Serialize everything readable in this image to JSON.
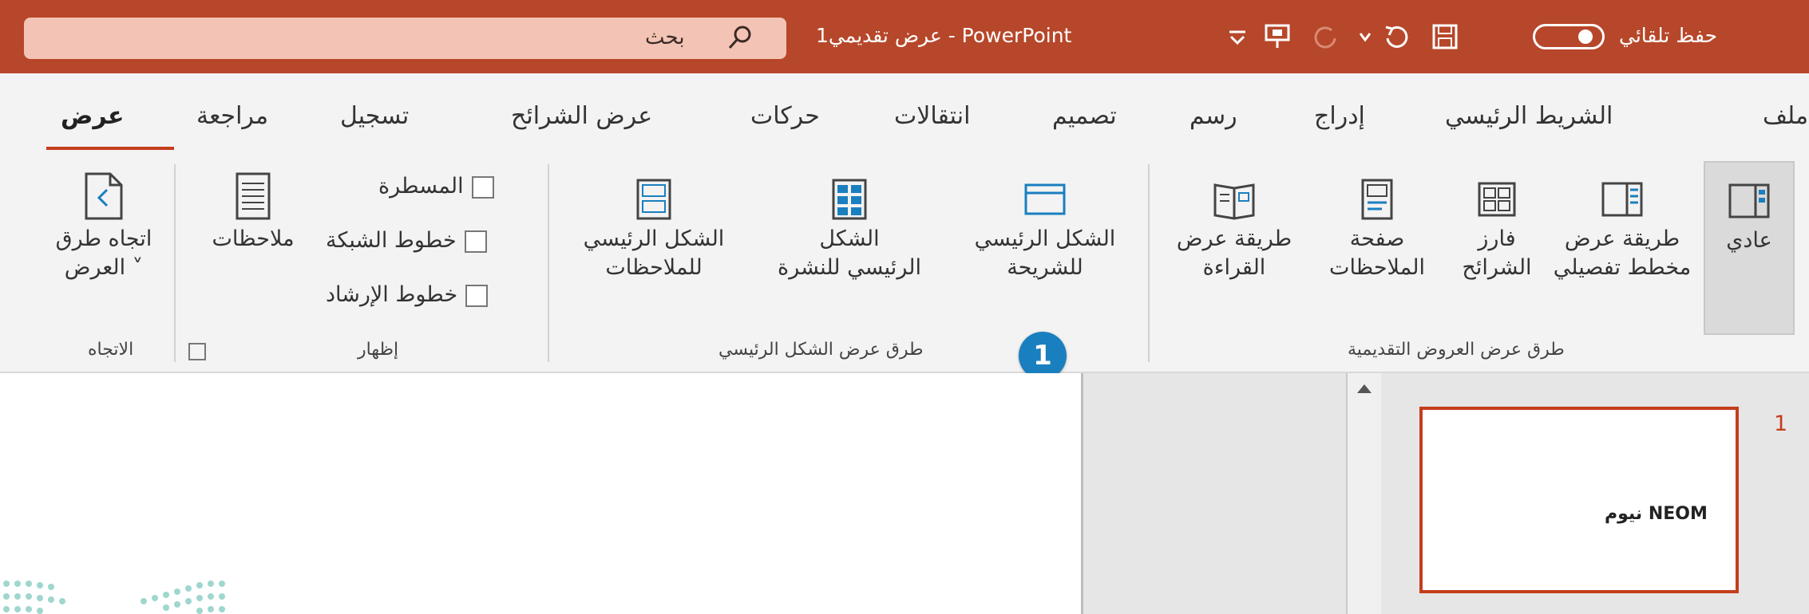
{
  "titlebar": {
    "autosave_label": "حفظ تلقائي",
    "doc_title": "عرض تقديمي1 - PowerPoint",
    "search_placeholder": "بحث",
    "color": "#b7472a"
  },
  "tabs": [
    {
      "label": "ملف"
    },
    {
      "label": "الشريط الرئيسي"
    },
    {
      "label": "إدراج"
    },
    {
      "label": "رسم"
    },
    {
      "label": "تصميم"
    },
    {
      "label": "انتقالات"
    },
    {
      "label": "حركات"
    },
    {
      "label": "عرض الشرائح"
    },
    {
      "label": "تسجيل"
    },
    {
      "label": "مراجعة"
    },
    {
      "label": "عرض",
      "active": true
    }
  ],
  "ribbon": {
    "presentation_views": {
      "group_label": "طرق عرض العروض التقديمية",
      "normal": "عادي",
      "outline_1": "طريقة عرض",
      "outline_2": "مخطط تفصيلي",
      "sorter_1": "فارز",
      "sorter_2": "الشرائح",
      "notes_page_1": "صفحة",
      "notes_page_2": "الملاحظات",
      "reading_1": "طريقة عرض",
      "reading_2": "القراءة"
    },
    "master_views": {
      "group_label": "طرق عرض الشكل الرئيسي",
      "slide_master_1": "الشكل الرئيسي",
      "slide_master_2": "للشريحة",
      "handout_master_1": "الشكل",
      "handout_master_2": "الرئيسي للنشرة",
      "notes_master_1": "الشكل الرئيسي",
      "notes_master_2": "للملاحظات"
    },
    "show": {
      "group_label": "إظهار",
      "ruler": "المسطرة",
      "gridlines": "خطوط الشبكة",
      "guides": "خطوط الإرشاد",
      "notes": "ملاحظات"
    },
    "direction": {
      "group_label": "الاتجاه",
      "label_1": "اتجاه طرق",
      "label_2": "العرض ˅"
    }
  },
  "callout": {
    "number": "1"
  },
  "slides_pane": {
    "slide_number": "1",
    "thumbnail_text": "نيوم NEOM"
  },
  "colors": {
    "accent": "#c43e1c",
    "callout": "#1a7fbf"
  }
}
